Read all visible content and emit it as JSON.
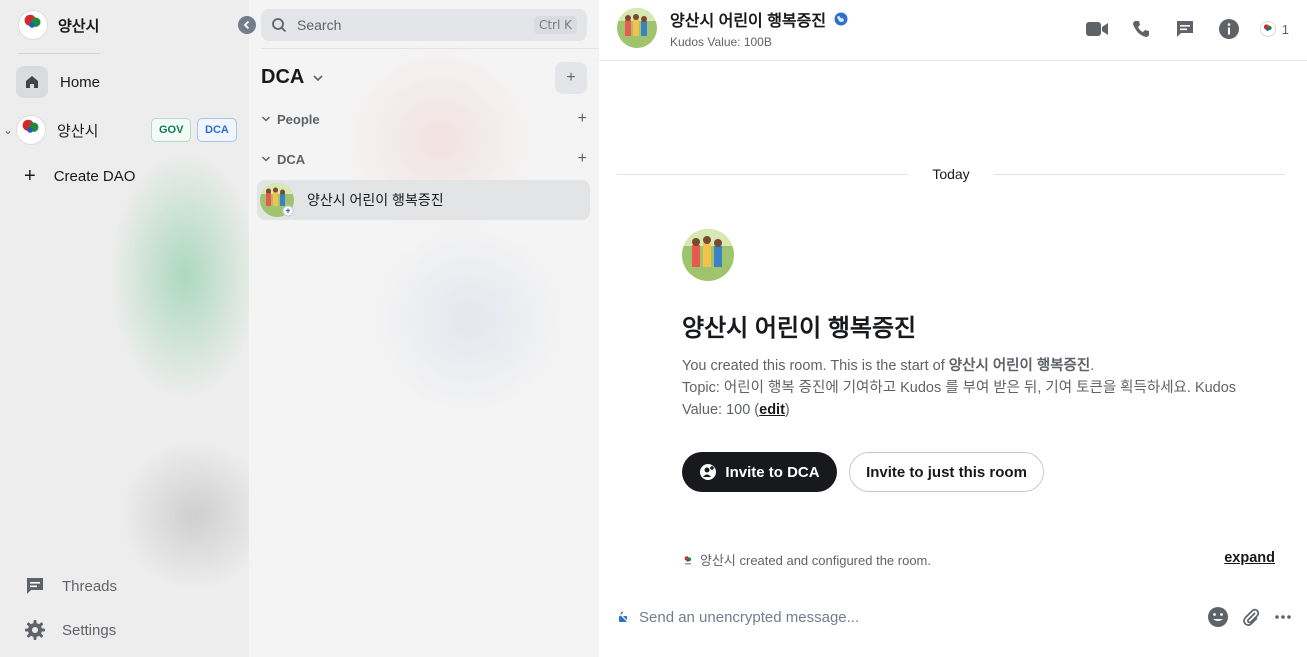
{
  "space_panel": {
    "space_name": "양산시",
    "nav": {
      "home_label": "Home",
      "space_item_label": "양산시",
      "gov_badge": "GOV",
      "dca_badge": "DCA",
      "create_dao_label": "Create DAO",
      "threads_label": "Threads",
      "settings_label": "Settings"
    },
    "logo_text": "양산시"
  },
  "room_list": {
    "search": {
      "placeholder": "Search",
      "shortcut": "Ctrl K"
    },
    "space_title": "DCA",
    "sections": {
      "people_label": "People",
      "dca_label": "DCA"
    },
    "rooms": [
      {
        "name": "양산시 어린이 행복증진"
      }
    ]
  },
  "room": {
    "header": {
      "name": "양산시 어린이 행복증진",
      "subtitle": "Kudos Value: 100B",
      "member_count": "1"
    },
    "timeline": {
      "date_separator": "Today",
      "intro_title": "양산시 어린이 행복증진",
      "intro_created_prefix": "You created this room. This is the start of ",
      "intro_created_room": "양산시 어린이 행복증진",
      "intro_created_suffix": ".",
      "topic_text": "Topic: 어린이 행복 증진에 기여하고 Kudos 를 부여 받은 뒤, 기여 토큰을 획득하세요. Kudos Value: 100 (",
      "topic_edit": "edit",
      "topic_close": ")",
      "invite_primary": "Invite to DCA",
      "invite_secondary": "Invite to just this room",
      "event_summary": "양산시 created and configured the room.",
      "expand_label": "expand"
    },
    "composer": {
      "placeholder": "Send an unencrypted message..."
    }
  },
  "colors": {
    "primary_button": "#17191c",
    "gov_badge": "#0b7a5a",
    "dca_badge": "#2f6fcf",
    "public_globe": "#2f6fcf"
  }
}
